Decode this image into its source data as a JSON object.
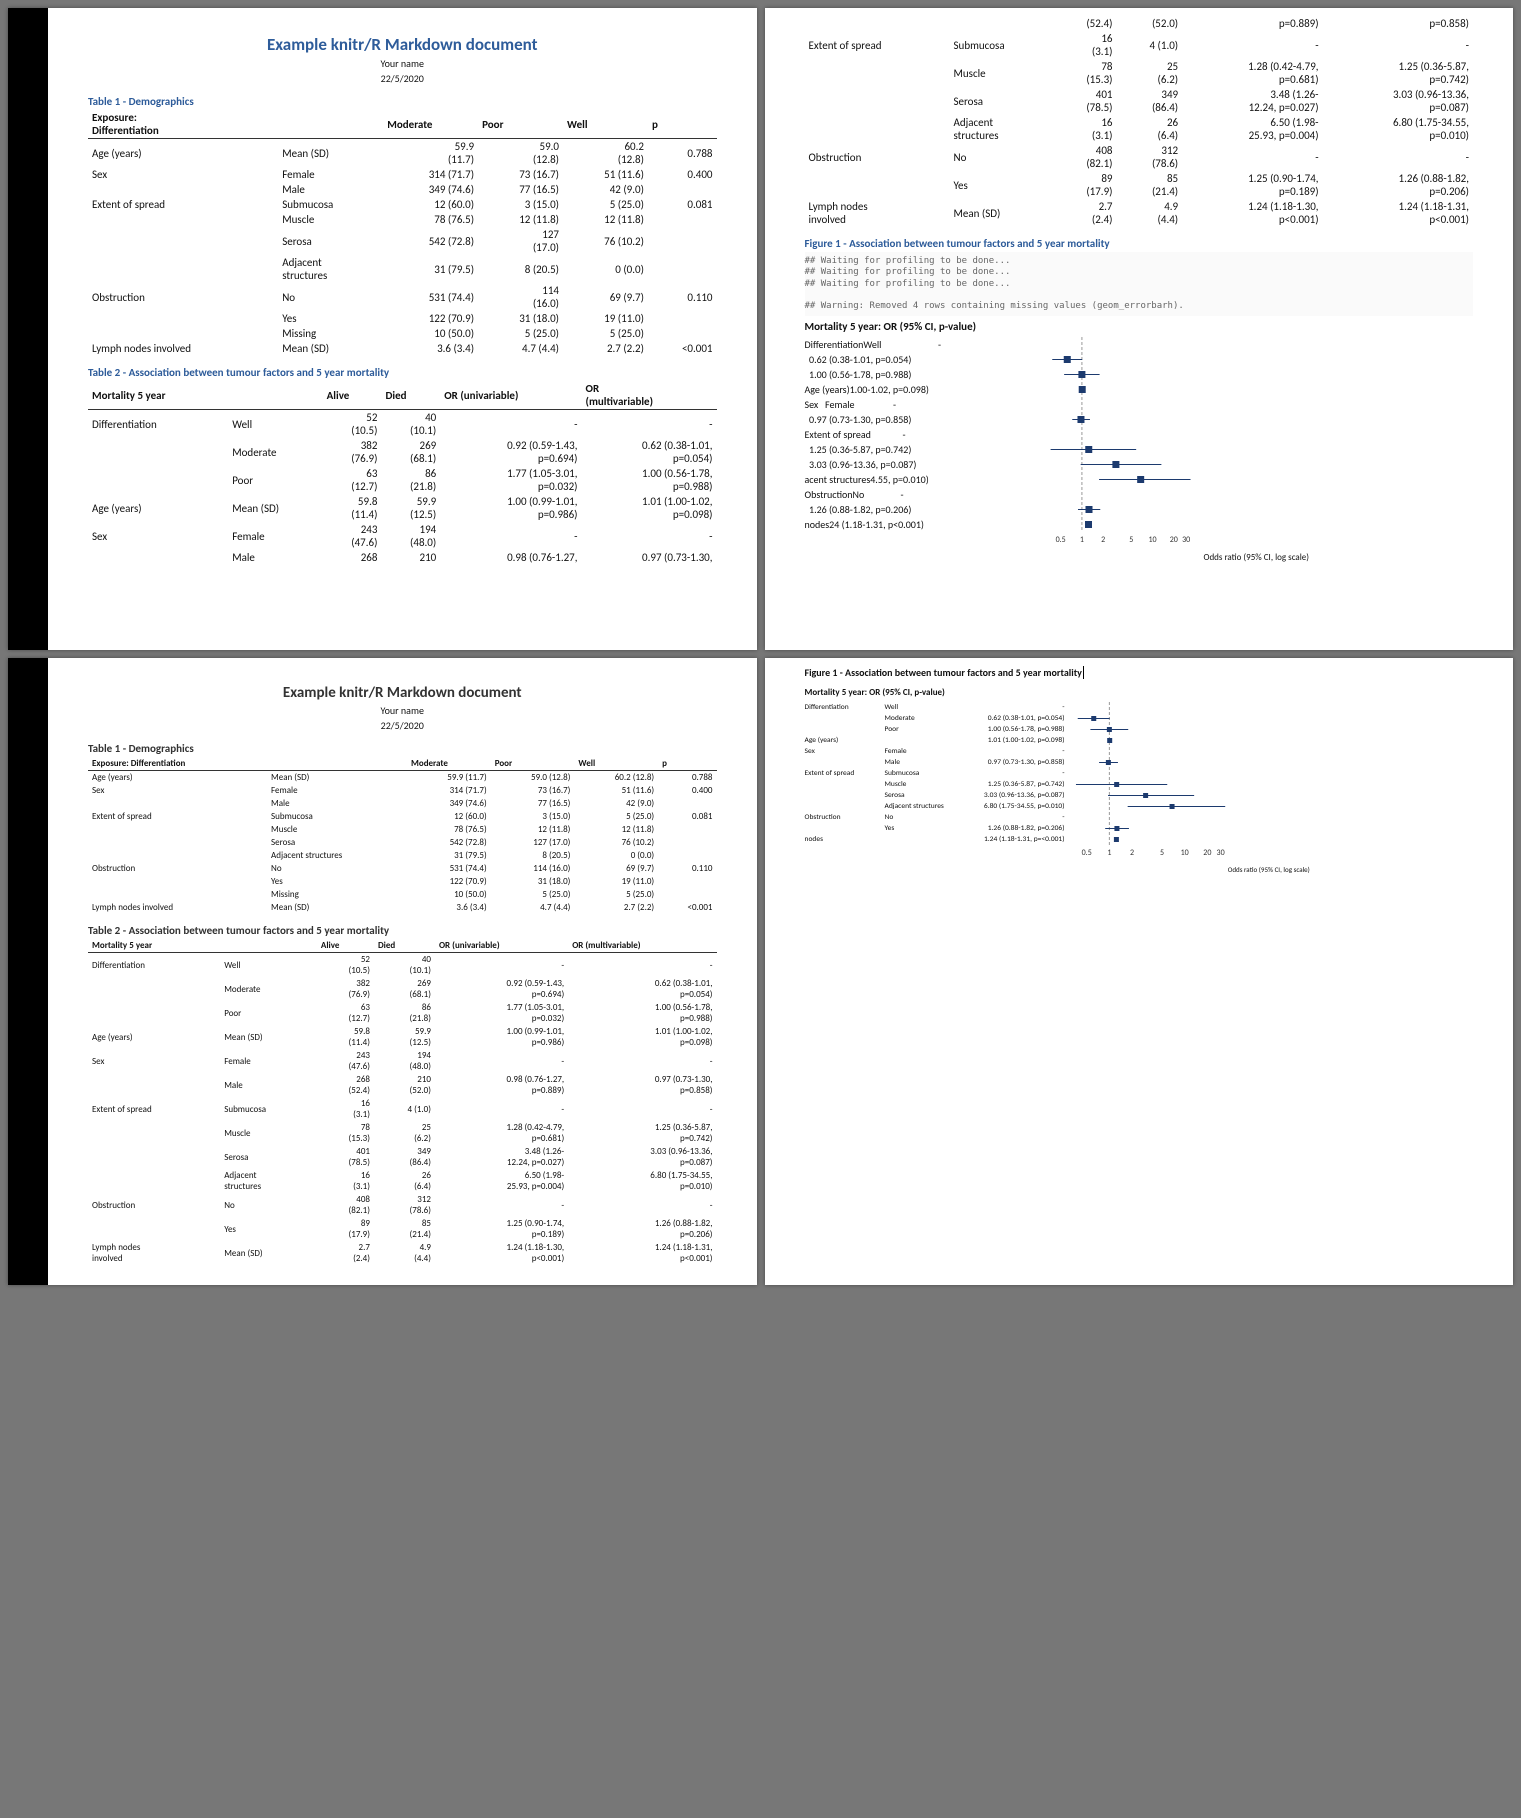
{
  "doc": {
    "title": "Example knitr/R Markdown document",
    "author": "Your name",
    "date": "22/5/2020"
  },
  "captions": {
    "t1": "Table 1 - Demographics",
    "t2": "Table 2 - Association between tumour factors and 5 year mortality",
    "f1": "Figure 1 - Association between tumour factors and 5 year mortality"
  },
  "t1": {
    "stub": "Exposure:\nDifferentiation",
    "stub_small": "Exposure: Differentiation",
    "cols": [
      "",
      "",
      "Moderate",
      "Poor",
      "Well",
      "p"
    ],
    "rows": [
      [
        "Age (years)",
        "Mean (SD)",
        "59.9\n(11.7)",
        "59.0\n(12.8)",
        "60.2\n(12.8)",
        "0.788"
      ],
      [
        "Sex",
        "Female",
        "314 (71.7)",
        "73 (16.7)",
        "51 (11.6)",
        "0.400"
      ],
      [
        "",
        "Male",
        "349 (74.6)",
        "77 (16.5)",
        "42 (9.0)",
        ""
      ],
      [
        "Extent of spread",
        "Submucosa",
        "12 (60.0)",
        "3 (15.0)",
        "5 (25.0)",
        "0.081"
      ],
      [
        "",
        "Muscle",
        "78 (76.5)",
        "12 (11.8)",
        "12 (11.8)",
        ""
      ],
      [
        "",
        "Serosa",
        "542 (72.8)",
        "127\n(17.0)",
        "76 (10.2)",
        ""
      ],
      [
        "",
        "Adjacent\nstructures",
        "31 (79.5)",
        "8 (20.5)",
        "0 (0.0)",
        ""
      ],
      [
        "Obstruction",
        "No",
        "531 (74.4)",
        "114\n(16.0)",
        "69 (9.7)",
        "0.110"
      ],
      [
        "",
        "Yes",
        "122 (70.9)",
        "31 (18.0)",
        "19 (11.0)",
        ""
      ],
      [
        "",
        "Missing",
        "10 (50.0)",
        "5 (25.0)",
        "5 (25.0)",
        ""
      ],
      [
        "Lymph nodes involved",
        "Mean (SD)",
        "3.6 (3.4)",
        "4.7 (4.4)",
        "2.7 (2.2)",
        "<0.001"
      ]
    ]
  },
  "t2": {
    "cols": [
      "Mortality 5 year",
      "",
      "Alive",
      "Died",
      "OR (univariable)",
      "OR\n(multivariable)"
    ],
    "rows": [
      [
        "Differentiation",
        "Well",
        "52\n(10.5)",
        "40\n(10.1)",
        "-",
        "-"
      ],
      [
        "",
        "Moderate",
        "382\n(76.9)",
        "269\n(68.1)",
        "0.92 (0.59-1.43,\np=0.694)",
        "0.62 (0.38-1.01,\np=0.054)"
      ],
      [
        "",
        "Poor",
        "63\n(12.7)",
        "86\n(21.8)",
        "1.77 (1.05-3.01,\np=0.032)",
        "1.00 (0.56-1.78,\np=0.988)"
      ],
      [
        "Age (years)",
        "Mean (SD)",
        "59.8\n(11.4)",
        "59.9\n(12.5)",
        "1.00 (0.99-1.01,\np=0.986)",
        "1.01 (1.00-1.02,\np=0.098)"
      ],
      [
        "Sex",
        "Female",
        "243\n(47.6)",
        "194\n(48.0)",
        "-",
        "-"
      ],
      [
        "",
        "Male",
        "268\n(52.4)",
        "210\n(52.0)",
        "0.98 (0.76-1.27,\np=0.889)",
        "0.97 (0.73-1.30,\np=0.858)"
      ],
      [
        "Extent of spread",
        "Submucosa",
        "16\n(3.1)",
        "4 (1.0)",
        "-",
        "-"
      ],
      [
        "",
        "Muscle",
        "78\n(15.3)",
        "25\n(6.2)",
        "1.28 (0.42-4.79,\np=0.681)",
        "1.25 (0.36-5.87,\np=0.742)"
      ],
      [
        "",
        "Serosa",
        "401\n(78.5)",
        "349\n(86.4)",
        "3.48 (1.26-\n12.24, p=0.027)",
        "3.03 (0.96-13.36,\np=0.087)"
      ],
      [
        "",
        "Adjacent\nstructures",
        "16\n(3.1)",
        "26\n(6.4)",
        "6.50 (1.98-\n25.93, p=0.004)",
        "6.80 (1.75-34.55,\np=0.010)"
      ],
      [
        "Obstruction",
        "No",
        "408\n(82.1)",
        "312\n(78.6)",
        "-",
        "-"
      ],
      [
        "",
        "Yes",
        "89\n(17.9)",
        "85\n(21.4)",
        "1.25 (0.90-1.74,\np=0.189)",
        "1.26 (0.88-1.82,\np=0.206)"
      ],
      [
        "Lymph nodes\ninvolved",
        "Mean (SD)",
        "2.7\n(2.4)",
        "4.9\n(4.4)",
        "1.24 (1.18-1.30,\np<0.001)",
        "1.24 (1.18-1.31,\np<0.001)"
      ]
    ]
  },
  "figcode": "## Waiting for profiling to be done...\n## Waiting for profiling to be done...\n## Waiting for profiling to be done...\n\n## Warning: Removed 4 rows containing missing values (geom_errorbarh).",
  "chart_data": {
    "type": "forest",
    "title": "Mortality 5 year: OR (95% CI, p-value)",
    "xlabel": "Odds ratio (95% CI, log scale)",
    "xscale_ticks": [
      0.5,
      1,
      2,
      5,
      10,
      20,
      30
    ],
    "groups": [
      {
        "group": "Differentiation",
        "rows": [
          {
            "label": "Well",
            "or": null,
            "lo": null,
            "hi": null,
            "p": null
          },
          {
            "label": "Moderate",
            "or": 0.62,
            "lo": 0.38,
            "hi": 1.01,
            "p": "0.054"
          },
          {
            "label": "Poor",
            "or": 1.0,
            "lo": 0.56,
            "hi": 1.78,
            "p": "0.988"
          }
        ]
      },
      {
        "group": "Age (years)",
        "rows": [
          {
            "label": "",
            "or": 1.01,
            "lo": 1.0,
            "hi": 1.02,
            "p": "0.098"
          }
        ]
      },
      {
        "group": "Sex",
        "rows": [
          {
            "label": "Female",
            "or": null,
            "lo": null,
            "hi": null,
            "p": null
          },
          {
            "label": "Male",
            "or": 0.97,
            "lo": 0.73,
            "hi": 1.3,
            "p": "0.858"
          }
        ]
      },
      {
        "group": "Extent of spread",
        "rows": [
          {
            "label": "Submucosa",
            "or": null,
            "lo": null,
            "hi": null,
            "p": null
          },
          {
            "label": "Muscle",
            "or": 1.25,
            "lo": 0.36,
            "hi": 5.87,
            "p": "0.742"
          },
          {
            "label": "Serosa",
            "or": 3.03,
            "lo": 0.96,
            "hi": 13.36,
            "p": "0.087"
          },
          {
            "label": "Adjacent structures",
            "or": 6.8,
            "lo": 1.75,
            "hi": 34.55,
            "p": "0.010"
          }
        ]
      },
      {
        "group": "Obstruction",
        "rows": [
          {
            "label": "No",
            "or": null,
            "lo": null,
            "hi": null,
            "p": null
          },
          {
            "label": "Yes",
            "or": 1.26,
            "lo": 0.88,
            "hi": 1.82,
            "p": "0.206"
          }
        ]
      },
      {
        "group": "nodes",
        "rows": [
          {
            "label": "",
            "or": 1.24,
            "lo": 1.18,
            "hi": 1.31,
            "p": "<0.001"
          }
        ]
      }
    ]
  },
  "forest_overlap_labels": [
    "DifferentiationWell                         -",
    "  0.62 (0.38-1.01, p=0.054)",
    "  1.00 (0.56-1.78, p=0.988)",
    "Age (years)1.00-1.02, p=0.098)",
    "Sex   Female                 -",
    "  0.97 (0.73-1.30, p=0.858)",
    "Extent of spread              -",
    "  1.25 (0.36-5.87, p=0.742)",
    "  3.03 (0.96-13.36, p=0.087)",
    "acent structures4.55, p=0.010)",
    "ObstructionNo                -",
    "  1.26 (0.88-1.82, p=0.206)",
    "nodes24 (1.18-1.31, p<0.001)"
  ]
}
